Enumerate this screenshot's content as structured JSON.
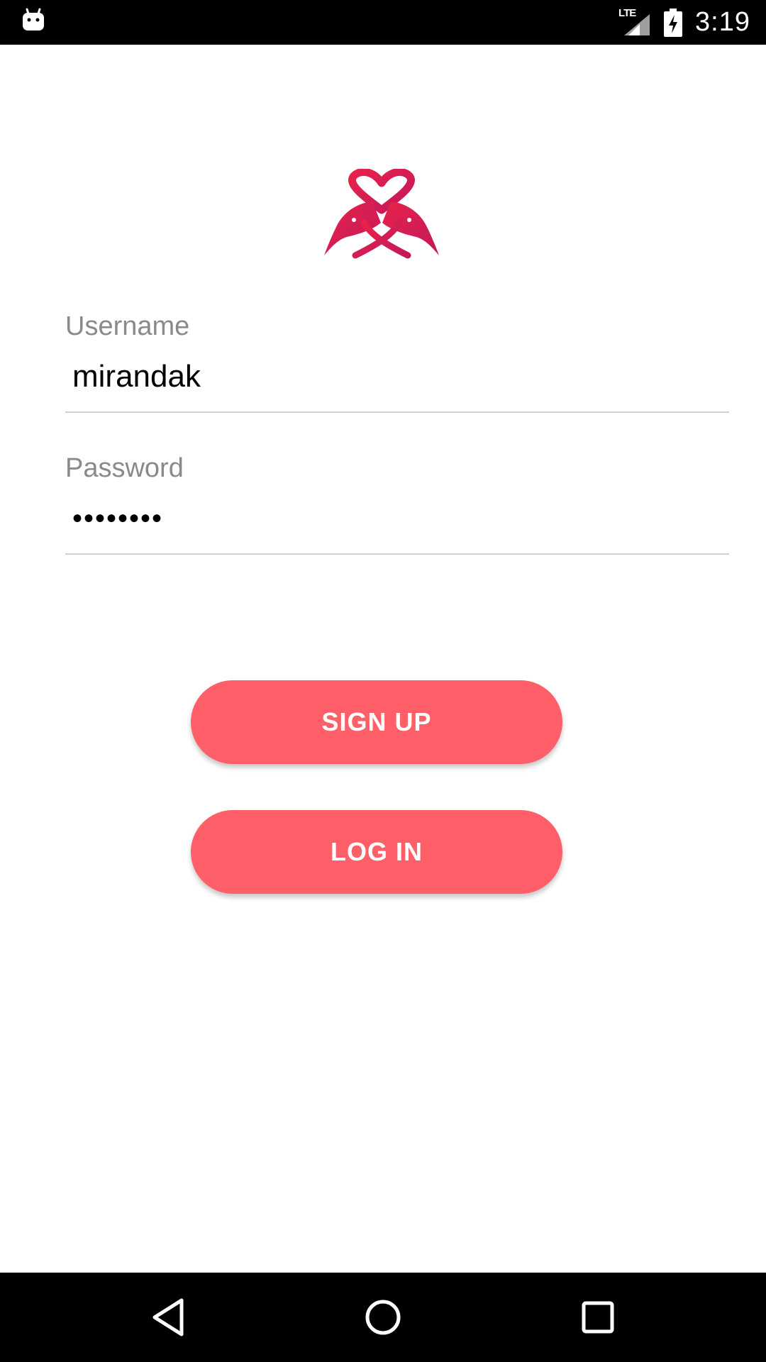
{
  "status_bar": {
    "time": "3:19",
    "network_label": "LTE",
    "left_icon": "android-debug-icon",
    "signal_icon": "cell-signal-icon",
    "battery_icon": "battery-charging-icon"
  },
  "logo": {
    "icon": "lovebirds-heart-logo",
    "colors": [
      "#e01a4f",
      "#c2185b"
    ]
  },
  "form": {
    "username": {
      "label": "Username",
      "value": "mirandak"
    },
    "password": {
      "label": "Password",
      "value": "••••••••"
    }
  },
  "buttons": {
    "signup_label": "SIGN UP",
    "login_label": "LOG IN",
    "accent_color": "#ff5f68"
  },
  "nav_bar": {
    "back_icon": "back-triangle-icon",
    "home_icon": "home-circle-icon",
    "recent_icon": "recent-apps-square-icon"
  }
}
